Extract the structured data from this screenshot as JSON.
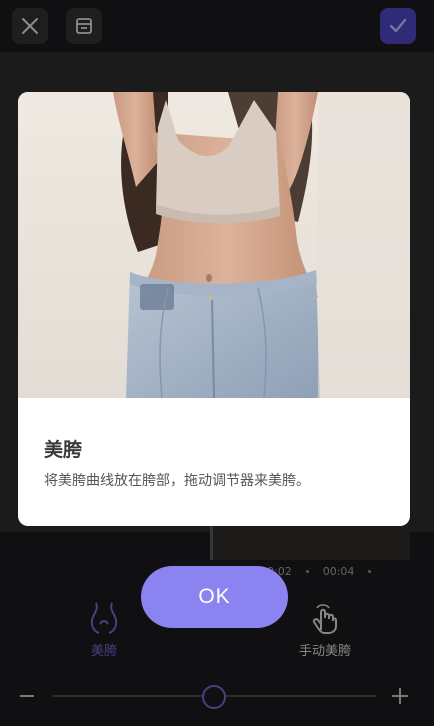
{
  "toolbar": {
    "close_icon": "close-icon",
    "compare_icon": "compare-icon",
    "confirm_icon": "check-icon",
    "confirm_color": "#4b43b7"
  },
  "timeline": {
    "times": [
      "00:02",
      "00:04"
    ]
  },
  "tools": {
    "waist_label": "美胯",
    "manual_label": "手动美胯",
    "accent": "#6d64c8"
  },
  "slider": {
    "value": 0.5
  },
  "dialog": {
    "title": "美胯",
    "description": "将美胯曲线放在胯部，拖动调节器来美胯。",
    "ok_label": "OK",
    "ok_color": "#8a83f0"
  }
}
